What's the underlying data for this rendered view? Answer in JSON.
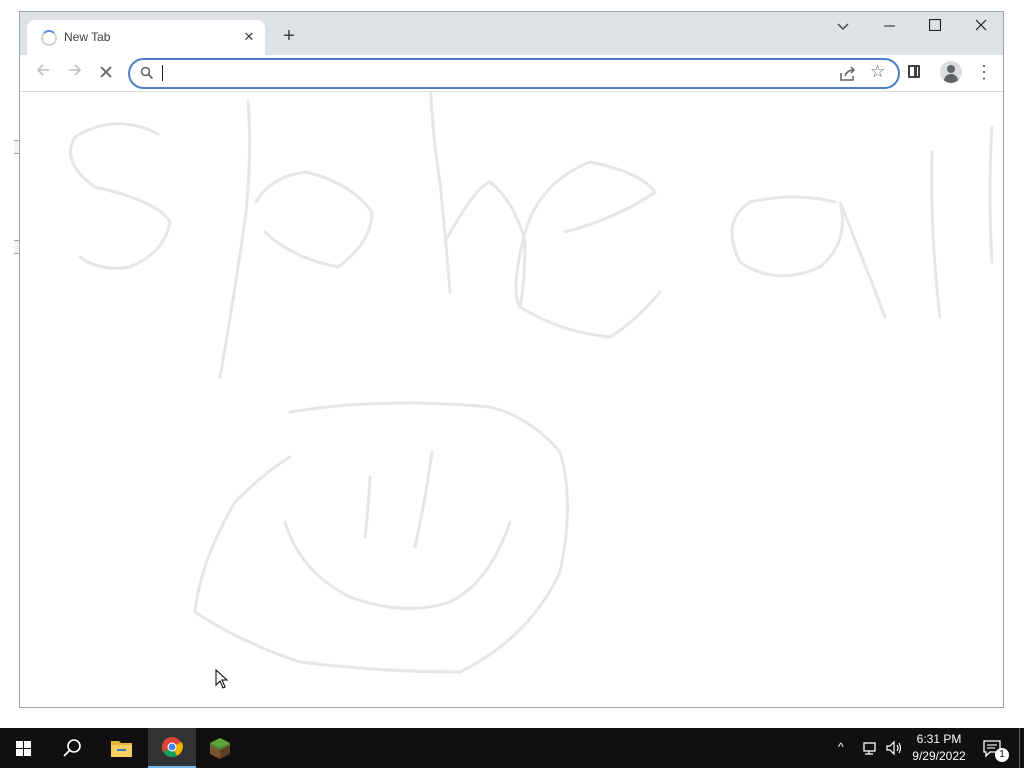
{
  "browser": {
    "tab": {
      "title": "New Tab"
    },
    "omnibox": {
      "value": "",
      "placeholder": ""
    },
    "colors": {
      "accent": "#4d80c9",
      "tabstrip": "#dee1e6"
    }
  },
  "icons": {
    "back": "arrow-left-icon",
    "forward": "arrow-right-icon",
    "stop": "close-icon",
    "search": "magnifier-icon",
    "share": "share-icon",
    "bookmark": "star-icon",
    "side_panel": "side-panel-icon",
    "profile": "person-icon",
    "menu": "kebab-icon"
  },
  "taskbar": {
    "clock": {
      "time": "6:31 PM",
      "date": "9/29/2022"
    },
    "notifications": {
      "count": "1"
    },
    "apps": [
      "start",
      "search",
      "file-explorer",
      "chrome",
      "minecraft"
    ]
  }
}
